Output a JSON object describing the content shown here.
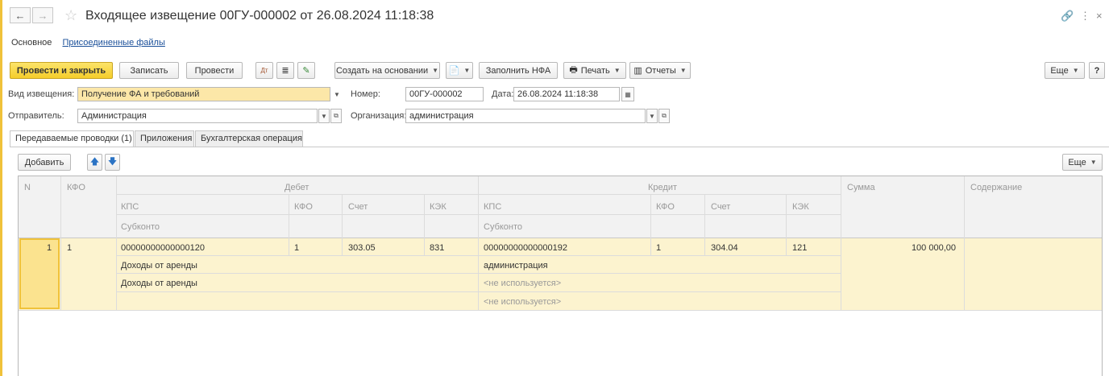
{
  "colors": {
    "accent": "#f5cd2a",
    "link": "#1a4f99",
    "rowHighlight": "#fcf3cf"
  },
  "window": {
    "title": "Входящее извещение 00ГУ-000002 от 26.08.2024 11:18:38",
    "back_icon": "arrow-left-icon",
    "forward_icon": "arrow-right-icon",
    "star_icon": "star-icon",
    "link_icon": "link-icon",
    "more_icon": "kebab-icon",
    "close_icon": "close-icon"
  },
  "sections": {
    "main": "Основное",
    "files": "Присоединенные файлы"
  },
  "toolbar": {
    "post_close": "Провести и закрыть",
    "save": "Записать",
    "post": "Провести",
    "create_based": "Создать на основании",
    "fill_nfa": "Заполнить НФА",
    "print": "Печать",
    "reports": "Отчеты",
    "more": "Еще",
    "help": "?"
  },
  "form": {
    "notice_type_label": "Вид извещения:",
    "notice_type_value": "Получение ФА и требований",
    "number_label": "Номер:",
    "number_value": "00ГУ-000002",
    "date_label": "Дата:",
    "date_value": "26.08.2024 11:18:38",
    "sender_label": "Отправитель:",
    "sender_value": "Администрация",
    "org_label": "Организация:",
    "org_value": "администрация"
  },
  "tabs": [
    {
      "label": "Передаваемые проводки (1)"
    },
    {
      "label": "Приложения"
    },
    {
      "label": "Бухгалтерская операция"
    }
  ],
  "table_toolbar": {
    "add": "Добавить",
    "more": "Еще"
  },
  "table": {
    "headers": {
      "n": "N",
      "kfo": "КФО",
      "debit": "Дебет",
      "credit": "Кредит",
      "kps": "КПС",
      "kfo2": "КФО",
      "account": "Счет",
      "kek": "КЭК",
      "subkonto": "Субконто",
      "sum": "Сумма",
      "content": "Содержание"
    },
    "rows": [
      {
        "n": "1",
        "kfo": "1",
        "debit_kps": "00000000000000120",
        "debit_kfo": "1",
        "debit_account": "303.05",
        "debit_kek": "831",
        "debit_sub1": "Доходы от аренды",
        "debit_sub2": "Доходы от аренды",
        "credit_kps": "00000000000000192",
        "credit_kfo": "1",
        "credit_account": "304.04",
        "credit_kek": "121",
        "credit_sub1": "администрация",
        "credit_sub2": "<не используется>",
        "credit_sub3": "<не используется>",
        "sum": "100 000,00",
        "content": ""
      }
    ]
  }
}
